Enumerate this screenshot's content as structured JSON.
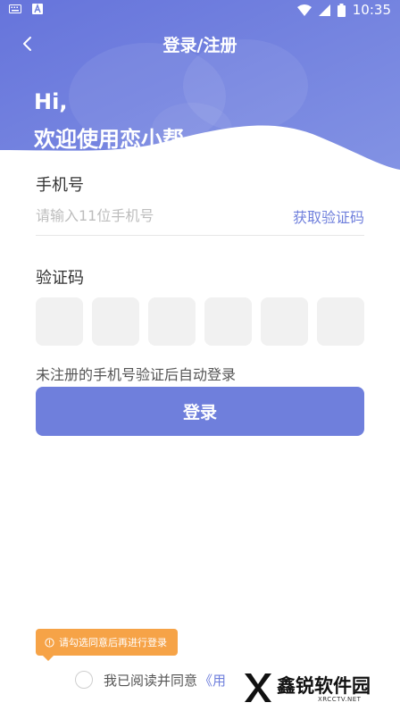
{
  "status_bar": {
    "time": "10:35",
    "icons": [
      "keyboard-icon",
      "text-app-icon",
      "wifi-icon",
      "signal-icon",
      "battery-icon"
    ]
  },
  "header": {
    "title": "登录/注册",
    "back_icon": "chevron-left-icon"
  },
  "greeting": {
    "line1": "Hi,",
    "line2": "欢迎使用恋小帮"
  },
  "phone": {
    "label": "手机号",
    "placeholder": "请输入11位手机号",
    "value": "",
    "get_code": "获取验证码"
  },
  "code": {
    "label": "验证码",
    "boxes": [
      "",
      "",
      "",
      "",
      "",
      ""
    ]
  },
  "hint": "未注册的手机号验证后自动登录",
  "login_button": "登录",
  "tooltip": {
    "icon": "info-icon",
    "text": "请勾选同意后再进行登录"
  },
  "agreement": {
    "text": "我已阅读并同意",
    "link": "《用"
  },
  "watermark": {
    "name": "鑫锐软件园",
    "sub": "XRCCTV.NET"
  },
  "colors": {
    "accent": "#6f7fdc",
    "tooltip": "#f6a347",
    "code_box": "#f1f1f1"
  }
}
